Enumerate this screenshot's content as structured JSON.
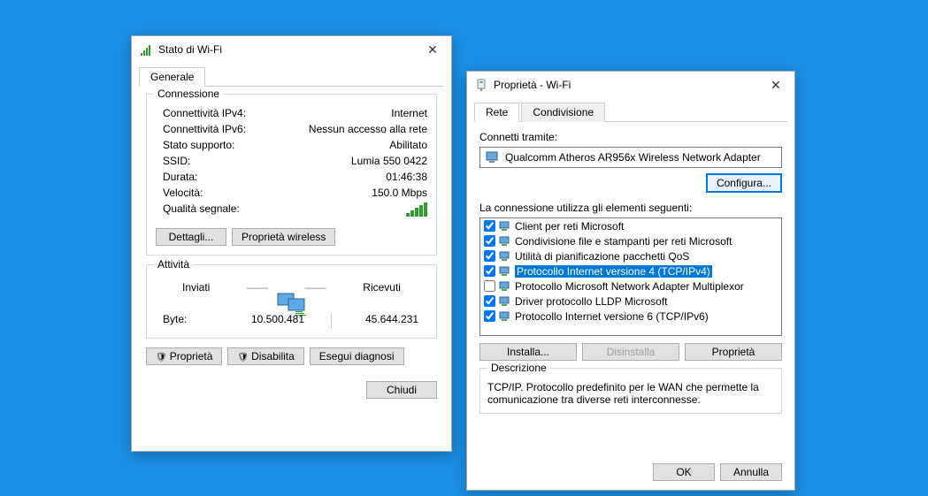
{
  "win1": {
    "title": "Stato di Wi-Fi",
    "tabs": {
      "general": "Generale"
    },
    "group_conn": "Connessione",
    "rows": {
      "ipv4_l": "Connettività IPv4:",
      "ipv4_v": "Internet",
      "ipv6_l": "Connettività IPv6:",
      "ipv6_v": "Nessun accesso alla rete",
      "state_l": "Stato supporto:",
      "state_v": "Abilitato",
      "ssid_l": "SSID:",
      "ssid_v": "Lumia 550 0422",
      "dur_l": "Durata:",
      "dur_v": "01:46:38",
      "spd_l": "Velocità:",
      "spd_v": "150.0 Mbps",
      "qual_l": "Qualità segnale:"
    },
    "btn_details": "Dettagli...",
    "btn_wprops": "Proprietà wireless",
    "group_act": "Attività",
    "act": {
      "sent": "Inviati",
      "recv": "Ricevuti",
      "byte": "Byte:",
      "sent_v": "10.500.481",
      "recv_v": "45.644.231"
    },
    "btn_props": "Proprietà",
    "btn_disable": "Disabilita",
    "btn_diag": "Esegui diagnosi",
    "btn_close": "Chiudi"
  },
  "win2": {
    "title": "Proprietà - Wi-Fi",
    "tabs": {
      "net": "Rete",
      "share": "Condivisione"
    },
    "connect_via": "Connetti tramite:",
    "adapter": "Qualcomm Atheros AR956x Wireless Network Adapter",
    "btn_configure": "Configura...",
    "uses_label": "La connessione utilizza gli elementi seguenti:",
    "items": [
      {
        "checked": true,
        "label": "Client per reti Microsoft"
      },
      {
        "checked": true,
        "label": "Condivisione file e stampanti per reti Microsoft"
      },
      {
        "checked": true,
        "label": "Utilità di pianificazione pacchetti QoS"
      },
      {
        "checked": true,
        "label": "Protocollo Internet versione 4 (TCP/IPv4)",
        "selected": true
      },
      {
        "checked": false,
        "label": "Protocollo Microsoft Network Adapter Multiplexor"
      },
      {
        "checked": true,
        "label": "Driver protocollo LLDP Microsoft"
      },
      {
        "checked": true,
        "label": "Protocollo Internet versione 6 (TCP/IPv6)"
      }
    ],
    "btn_install": "Installa...",
    "btn_uninstall": "Disinstalla",
    "btn_props": "Proprietà",
    "desc_title": "Descrizione",
    "desc_text": "TCP/IP. Protocollo predefinito per le WAN che permette la comunicazione tra diverse reti interconnesse.",
    "btn_ok": "OK",
    "btn_cancel": "Annulla"
  }
}
